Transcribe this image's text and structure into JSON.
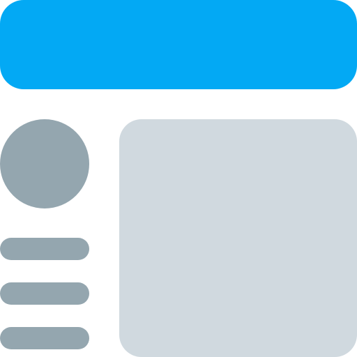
{
  "icon": "website-layout-icon",
  "colors": {
    "header": "#03A9F4",
    "avatar": "#94A6AF",
    "menu_lines": "#94A6AF",
    "content_panel": "#D0D9DF",
    "background": "#FFFFFF"
  },
  "menu": {
    "items": [
      {
        "icon": "menu-line"
      },
      {
        "icon": "menu-line"
      },
      {
        "icon": "menu-line"
      }
    ]
  }
}
